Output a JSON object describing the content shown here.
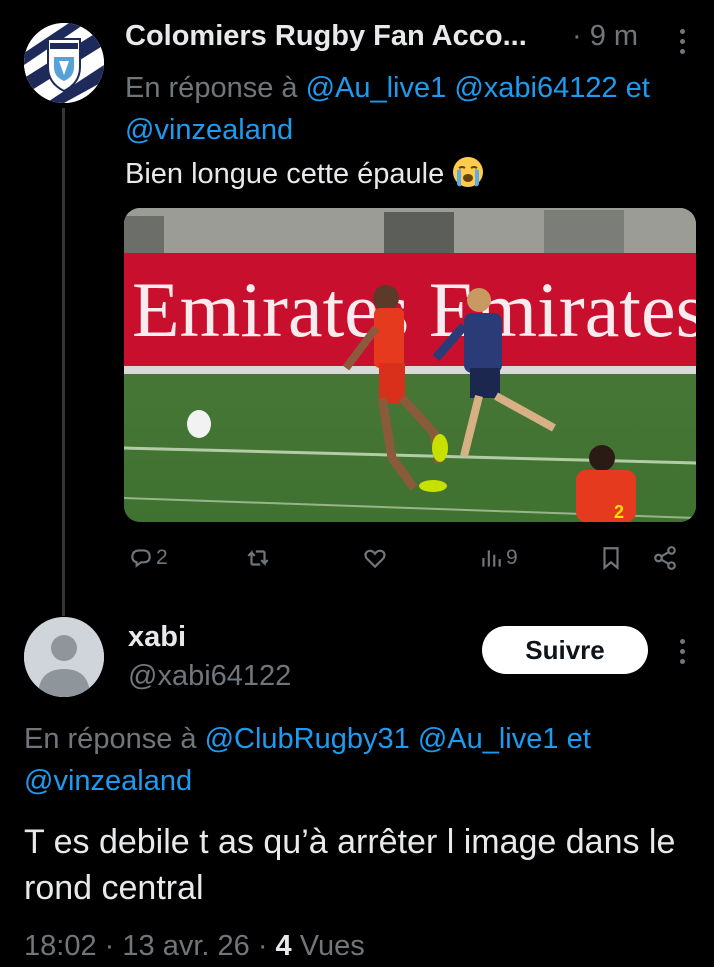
{
  "tweet1": {
    "author_name": "Colomiers Rugby Fan Acco...",
    "time": "· 9 m",
    "reply_prefix": "En réponse à",
    "mention_1": "@Au_live1",
    "mention_2": "@xabi64122",
    "mention_joiner": "et",
    "mention_3": "@vinzealand",
    "text": "Bien longue cette épaule",
    "emoji": "loudly-crying-face",
    "media_banner_text": "Emirates Emirates",
    "player_number": "2",
    "actions": {
      "reply_count": "2",
      "retweet_count": "",
      "like_count": "",
      "views_count": "9"
    }
  },
  "tweet2": {
    "author_name": "xabi",
    "handle": "@xabi64122",
    "follow_label": "Suivre",
    "reply_prefix": "En réponse à",
    "mention_1": "@ClubRugby31",
    "mention_2": "@Au_live1",
    "mention_joiner": "et",
    "mention_3": "@vinzealand",
    "text": "T es debile t as qu’à arrêter l image dans le rond central",
    "time": "18:02",
    "date": "13 avr. 26",
    "views_count": "4",
    "views_label": "Vues",
    "separator": "·"
  },
  "colors": {
    "background": "#000000",
    "text_primary": "#e7e9ea",
    "text_secondary": "#71767b",
    "link": "#1d9bf0",
    "follow_button_bg": "#ffffff"
  }
}
